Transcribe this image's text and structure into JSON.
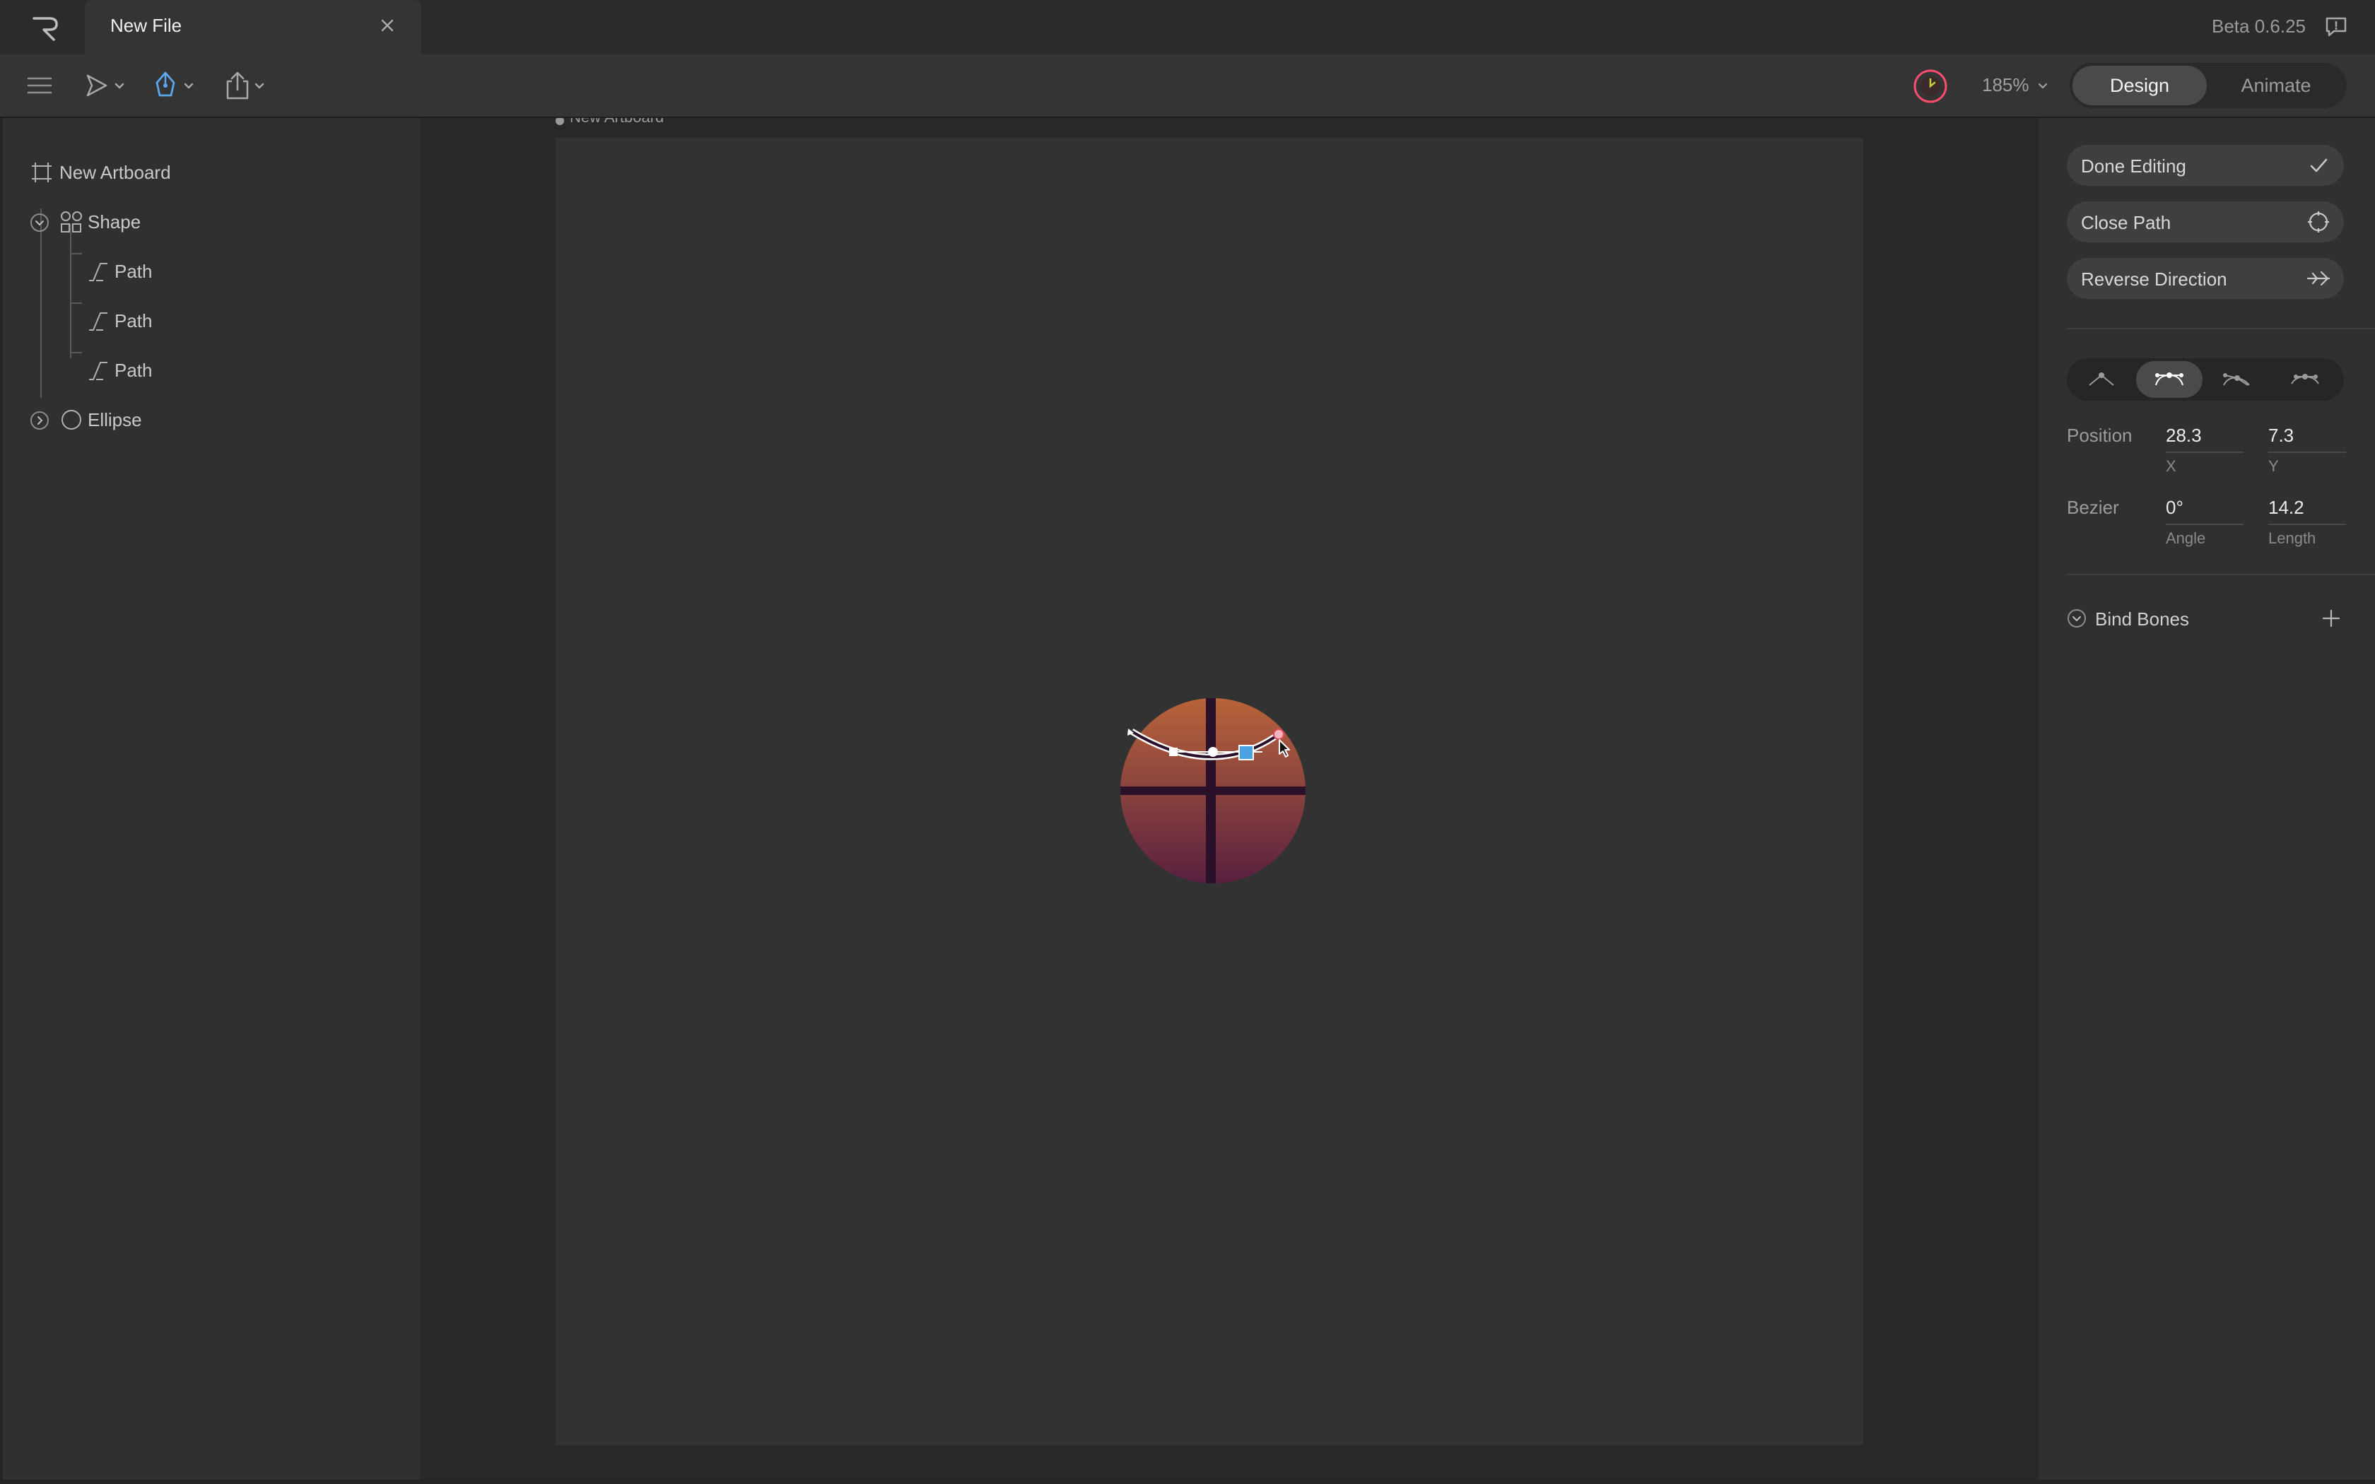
{
  "titlebar": {
    "tab_title": "New File",
    "version": "Beta 0.6.25",
    "icons": [
      "rive-logo-icon",
      "close-icon",
      "feedback-icon"
    ]
  },
  "toolbar": {
    "zoom": "185%",
    "modes": {
      "design": "Design",
      "animate": "Animate",
      "active": "design"
    },
    "icons": [
      "menu-icon",
      "select-tool-icon",
      "pen-tool-icon",
      "export-icon",
      "record-icon"
    ]
  },
  "hierarchy": {
    "items": [
      {
        "label": "New Artboard",
        "icon": "artboard-icon"
      },
      {
        "label": "Shape",
        "icon": "shape-icon",
        "expanded": true
      },
      {
        "label": "Path",
        "icon": "path-icon"
      },
      {
        "label": "Path",
        "icon": "path-icon"
      },
      {
        "label": "Path",
        "icon": "path-icon"
      },
      {
        "label": "Ellipse",
        "icon": "ellipse-icon",
        "expanded": false
      }
    ]
  },
  "stage": {
    "artboard_label": "New Artboard",
    "artboard_color": "#323232",
    "shape_gradient": [
      "#b8643a",
      "#5a2040"
    ],
    "cross_color": "#2a1028",
    "selection_color": "#4aa3e0"
  },
  "inspector": {
    "actions": [
      {
        "label": "Done Editing",
        "icon": "check-icon"
      },
      {
        "label": "Close Path",
        "icon": "close-path-icon"
      },
      {
        "label": "Reverse Direction",
        "icon": "reverse-direction-icon"
      }
    ],
    "vertex_modes": [
      "corner-vertex-icon",
      "mirrored-vertex-icon",
      "detached-vertex-icon",
      "asymmetric-vertex-icon"
    ],
    "vertex_mode_active": 1,
    "position": {
      "label": "Position",
      "x": "28.3",
      "x_label": "X",
      "y": "7.3",
      "y_label": "Y"
    },
    "bezier": {
      "label": "Bezier",
      "angle": "0°",
      "angle_label": "Angle",
      "length": "14.2",
      "length_label": "Length"
    },
    "bind_bones": "Bind Bones"
  }
}
